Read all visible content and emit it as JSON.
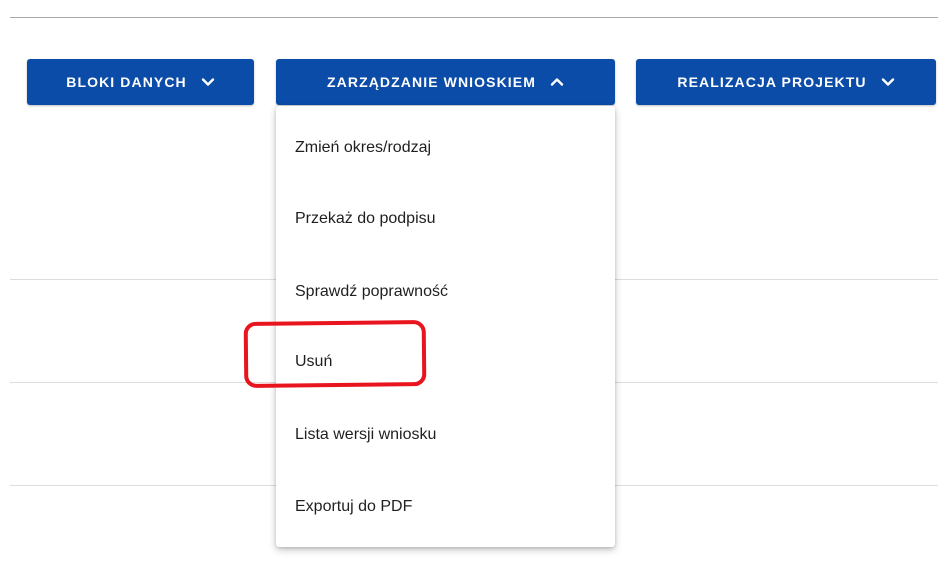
{
  "toolbar": {
    "buttons": [
      {
        "label": "BLOKI DANYCH",
        "chevron": "chevron-down-icon"
      },
      {
        "label": "ZARZĄDZANIE WNIOSKIEM",
        "chevron": "chevron-up-icon"
      },
      {
        "label": "REALIZACJA PROJEKTU",
        "chevron": "chevron-down-icon"
      }
    ]
  },
  "dropdown": {
    "items": [
      {
        "label": "Zmień okres/rodzaj"
      },
      {
        "label": "Przekaż do podpisu"
      },
      {
        "label": "Sprawdź poprawność"
      },
      {
        "label": "Usuń"
      },
      {
        "label": "Lista wersji wniosku"
      },
      {
        "label": "Exportuj do PDF"
      }
    ]
  },
  "colors": {
    "button_bg": "#0b4ca8",
    "button_text": "#ffffff",
    "highlight": "#e8141e",
    "menu_text": "#1f1f1f"
  }
}
